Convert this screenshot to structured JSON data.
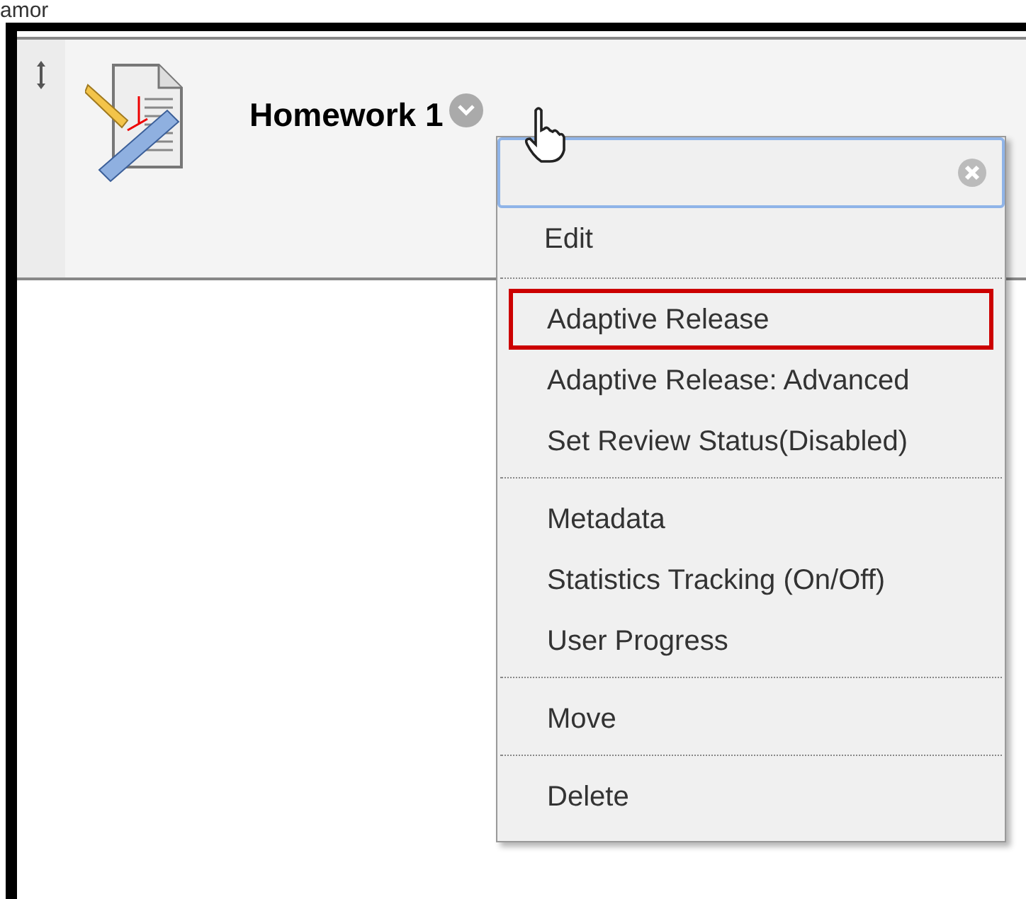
{
  "caption": "amor",
  "item": {
    "title": "Homework 1"
  },
  "menu": {
    "groups": [
      [
        {
          "label": "Edit",
          "selected": false
        }
      ],
      [
        {
          "label": "Adaptive Release",
          "selected": true
        },
        {
          "label": "Adaptive Release: Advanced",
          "selected": false
        },
        {
          "label": "Set Review Status(Disabled)",
          "selected": false
        }
      ],
      [
        {
          "label": "Metadata",
          "selected": false
        },
        {
          "label": "Statistics Tracking (On/Off)",
          "selected": false
        },
        {
          "label": "User Progress",
          "selected": false
        }
      ],
      [
        {
          "label": "Move",
          "selected": false
        }
      ],
      [
        {
          "label": "Delete",
          "selected": false
        }
      ]
    ]
  }
}
